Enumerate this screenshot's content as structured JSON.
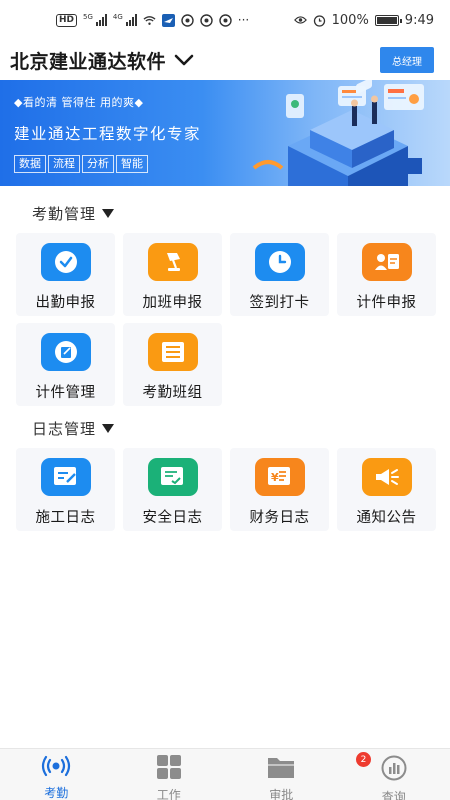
{
  "status_bar": {
    "network_badge": "HD",
    "signal1_label": "5G",
    "signal2_label": "4G",
    "battery": "100%",
    "time": "9:49",
    "battery_level": 1.0
  },
  "header": {
    "company": "北京建业通达软件",
    "role_button": "总经理"
  },
  "banner": {
    "slogan": "◆看的清 管得住 用的爽◆",
    "title": "建业通达工程数字化专家",
    "tags": [
      "数据",
      "流程",
      "分析",
      "智能"
    ]
  },
  "attendance": {
    "title": "考勤管理",
    "items": [
      {
        "label": "出勤申报",
        "icon": "checkmark-icon",
        "color": "#1d8cf0"
      },
      {
        "label": "加班申报",
        "icon": "lamp-icon",
        "color": "#fa9a12"
      },
      {
        "label": "签到打卡",
        "icon": "clock-icon",
        "color": "#1d8cf0"
      },
      {
        "label": "计件申报",
        "icon": "person-card-icon",
        "color": "#f7861c"
      },
      {
        "label": "计件管理",
        "icon": "edit-document-icon",
        "color": "#1d8cf0"
      },
      {
        "label": "考勤班组",
        "icon": "list-icon",
        "color": "#fa9a12"
      }
    ]
  },
  "logs": {
    "title": "日志管理",
    "items": [
      {
        "label": "施工日志",
        "icon": "edit-note-icon",
        "color": "#1d8cf0"
      },
      {
        "label": "安全日志",
        "icon": "safety-note-icon",
        "color": "#1bb178"
      },
      {
        "label": "财务日志",
        "icon": "yuan-note-icon",
        "color": "#f7861c"
      },
      {
        "label": "通知公告",
        "icon": "megaphone-icon",
        "color": "#fa9a12"
      }
    ]
  },
  "bottom_nav": {
    "items": [
      {
        "label": "考勤",
        "icon": "broadcast-icon",
        "active": true
      },
      {
        "label": "工作",
        "icon": "grid-icon",
        "active": false
      },
      {
        "label": "审批",
        "icon": "folder-icon",
        "active": false,
        "badge": "2"
      },
      {
        "label": "查询",
        "icon": "chart-circle-icon",
        "active": false
      }
    ]
  }
}
